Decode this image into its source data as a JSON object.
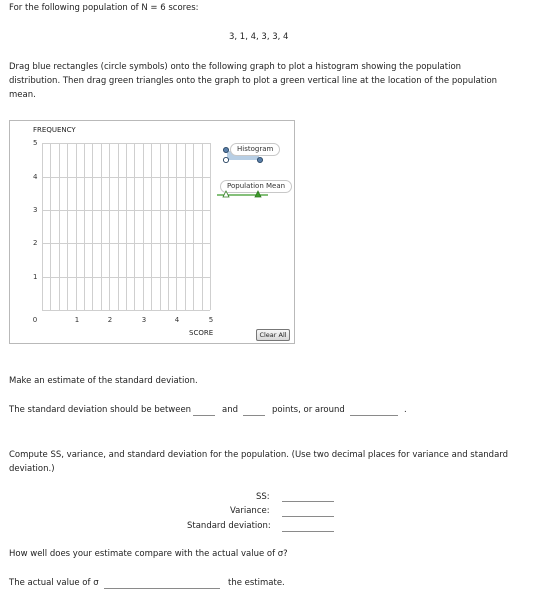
{
  "intro": "For the following population of N = 6 scores:",
  "scores": "3, 1, 4, 3, 3, 4",
  "instructions": "Drag blue rectangles (circle symbols) onto the following graph to plot a histogram showing the population distribution. Then drag green triangles onto the graph to plot a green vertical line at the location of the population mean.",
  "graph": {
    "y_axis_label": "FREQUENCY",
    "x_axis_label": "SCORE",
    "y_ticks": [
      "5",
      "4",
      "3",
      "2",
      "1"
    ],
    "x_ticks": [
      "0",
      "1",
      "2",
      "3",
      "4",
      "5"
    ],
    "histogram_label": "Histogram",
    "mean_label": "Population Mean",
    "clear_button": "Clear All"
  },
  "estimate": {
    "heading": "Make an estimate of the standard deviation.",
    "prefix": "The standard deviation should be between",
    "and": "and",
    "suffix": "points, or around",
    "period": "."
  },
  "compute": {
    "instructions": "Compute SS, variance, and standard deviation for the population. (Use two decimal places for variance and standard deviation.)",
    "ss_label": "SS:",
    "variance_label": "Variance:",
    "sd_label": "Standard deviation:"
  },
  "compare": {
    "question": "How well does your estimate compare with the actual value of σ?",
    "prefix": "The actual value of σ",
    "suffix": "the estimate."
  },
  "colors": {
    "histogram_blue": "#b7cee4",
    "mean_green": "#3c9a2a",
    "handle_blue": "#5a7fa8"
  }
}
